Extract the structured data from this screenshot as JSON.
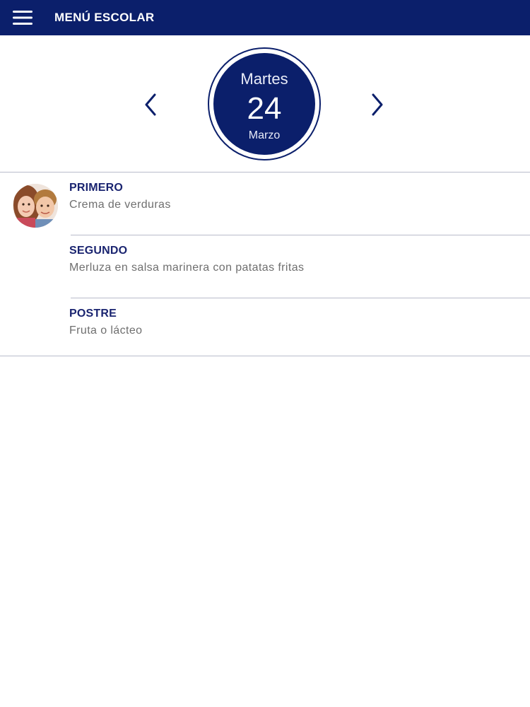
{
  "header": {
    "title": "MENÚ ESCOLAR",
    "menu_icon": "hamburger-menu-icon",
    "background": "#0b1f6b"
  },
  "date": {
    "weekday": "Martes",
    "day": "24",
    "month": "Marzo",
    "prev_icon": "chevron-left-icon",
    "next_icon": "chevron-right-icon",
    "accent": "#0b1f6b"
  },
  "menu": {
    "courses": [
      {
        "title": "PRIMERO",
        "dish": "Crema de verduras"
      },
      {
        "title": "SEGUNDO",
        "dish": "Merluza en salsa marinera con patatas fritas"
      },
      {
        "title": "POSTRE",
        "dish": "Fruta o lácteo"
      }
    ]
  }
}
